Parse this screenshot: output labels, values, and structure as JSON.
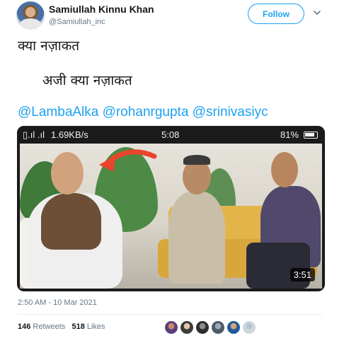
{
  "tweet": {
    "author_name": "Samiullah Kinnu Khan",
    "author_handle": "@Samiullah_inc",
    "follow_label": "Follow",
    "line1": "क्या नज़ाकत",
    "line2": "अजी क्या नज़ाकत",
    "mentions": [
      "@LambaAlka",
      "@rohanrgupta",
      "@srinivasiyc"
    ],
    "timestamp": "2:50 AM - 10 Mar 2021",
    "retweets_count": "146",
    "retweets_label": "Retweets",
    "likes_count": "518",
    "likes_label": "Likes"
  },
  "media": {
    "status_signal": "▯.ıl .ıl",
    "status_speed": "1.69KB/s",
    "status_time": "5:08",
    "status_battery": "81%",
    "video_duration": "3:51"
  },
  "colors": {
    "accent": "#1da1f2",
    "text": "#14171a",
    "muted": "#657786",
    "arrow": "#e8452c"
  },
  "icons": {
    "chevron": "chevron-down-icon",
    "battery": "battery-icon",
    "avatar": "avatar"
  }
}
